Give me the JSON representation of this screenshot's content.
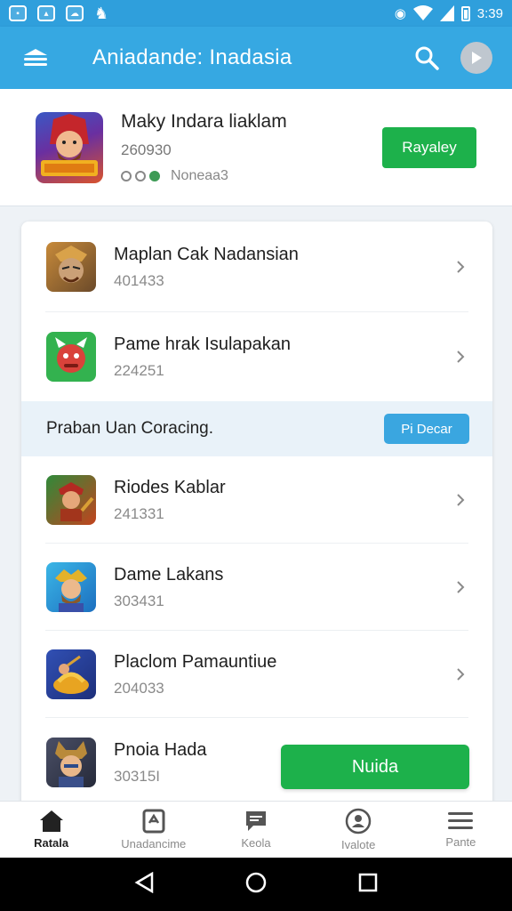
{
  "status_bar": {
    "time": "3:39"
  },
  "app_bar": {
    "title": "Aniadande: Inadasia"
  },
  "featured": {
    "name": "Maky Indara liaklam",
    "count": "260930",
    "meta": "Noneaa3",
    "button_label": "Rayaley"
  },
  "list_top": [
    {
      "name": "Maplan Cak Nadansian",
      "count": "401433"
    },
    {
      "name": "Pame hrak Isulapakan",
      "count": "224251"
    }
  ],
  "section": {
    "label": "Praban Uan Coracing.",
    "button_label": "Pi Decar"
  },
  "list_bottom": [
    {
      "name": "Riodes Kablar",
      "count": "241331"
    },
    {
      "name": "Dame Lakans",
      "count": "303431"
    },
    {
      "name": "Placlom Pamauntiue",
      "count": "204033"
    },
    {
      "name": "Pnoia Hada",
      "count": "30315I"
    }
  ],
  "big_button": {
    "label": "Nuida"
  },
  "bottom_nav": [
    {
      "label": "Ratala",
      "icon": "home-icon",
      "active": true
    },
    {
      "label": "Unadancime",
      "icon": "store-icon",
      "active": false
    },
    {
      "label": "Keola",
      "icon": "message-icon",
      "active": false
    },
    {
      "label": "Ivalote",
      "icon": "gamepad-icon",
      "active": false
    },
    {
      "label": "Pante",
      "icon": "menu-icon",
      "active": false
    }
  ],
  "colors": {
    "primary": "#36a8e2",
    "green": "#1db14b",
    "status_bar": "#2f9fdc"
  }
}
